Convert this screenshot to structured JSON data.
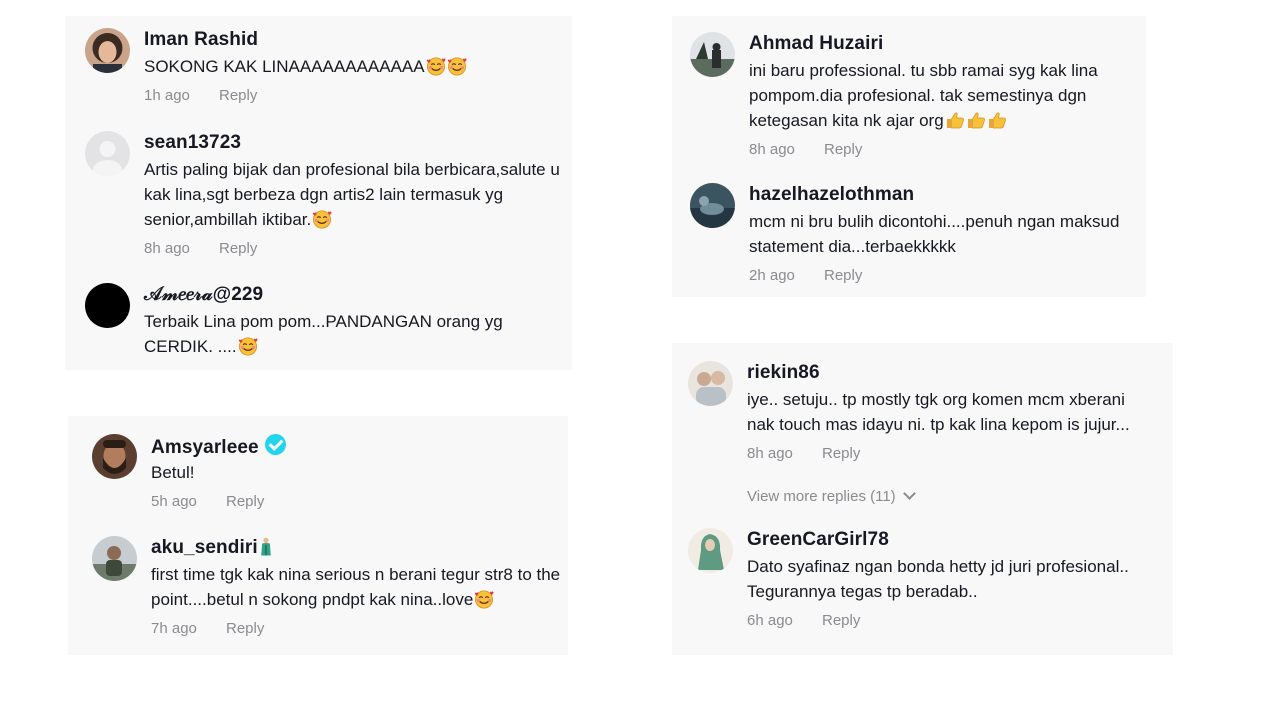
{
  "reply_label": "Reply",
  "panels": [
    {
      "comments": [
        {
          "username": "Iman Rashid",
          "text": "SOKONG KAK LINAAAAAAAAAAAA",
          "emoji": [
            "smiling-face-with-hearts",
            "smiling-face-with-hearts"
          ],
          "time": "1h ago"
        },
        {
          "username": "sean13723",
          "text": "Artis paling bijak dan profesional bila berbicara,salute u kak lina,sgt berbeza dgn artis2 lain termasuk yg senior,ambillah iktibar.",
          "emoji": [
            "smiling-face-with-hearts"
          ],
          "time": "8h ago"
        },
        {
          "username": "𝒜𝓂𝑒𝑒𝓇𝒶@229",
          "text": "Terbaik Lina pom pom...PANDANGAN orang yg CERDIK. ....",
          "emoji": [
            "smiling-face-with-hearts"
          ],
          "time": ""
        }
      ]
    },
    {
      "comments": [
        {
          "username": "Amsyarleee",
          "verified": true,
          "text": "Betul!",
          "time": "5h ago"
        },
        {
          "username": "aku_sendiri",
          "username_emoji": "person-in-green-robe",
          "text": "first time tgk kak nina serious n berani tegur str8 to the point....betul n sokong pndpt kak nina..love",
          "emoji": [
            "smiling-face-with-hearts"
          ],
          "time": "7h ago"
        }
      ]
    },
    {
      "comments": [
        {
          "username": "Ahmad Huzairi",
          "text": "ini baru professional. tu sbb ramai syg kak lina pompom.dia profesional. tak semestinya dgn ketegasan kita nk ajar org",
          "emoji": [
            "thumbs-up",
            "thumbs-up",
            "thumbs-up"
          ],
          "time": "8h ago"
        },
        {
          "username": "hazelhazelothman",
          "text": "mcm ni bru bulih dicontohi....penuh ngan maksud statement dia...terbaekkkkk",
          "time": "2h ago"
        }
      ]
    },
    {
      "comments": [
        {
          "username": "riekin86",
          "text": "iye.. setuju.. tp mostly tgk org komen mcm xberani nak touch mas idayu ni. tp kak lina kepom is jujur...",
          "time": "8h ago"
        },
        {
          "username": "GreenCarGirl78",
          "text": "Dato syafinaz ngan bonda hetty jd juri profesional.. Tegurannya tegas tp beradab..",
          "time": "6h ago"
        }
      ],
      "view_more": "View more replies (11)"
    }
  ],
  "colors": {
    "panel_bg": "#f8f8f8",
    "meta_text": "#8a8b91",
    "verified": "#20d5ec",
    "username": "#161823"
  }
}
